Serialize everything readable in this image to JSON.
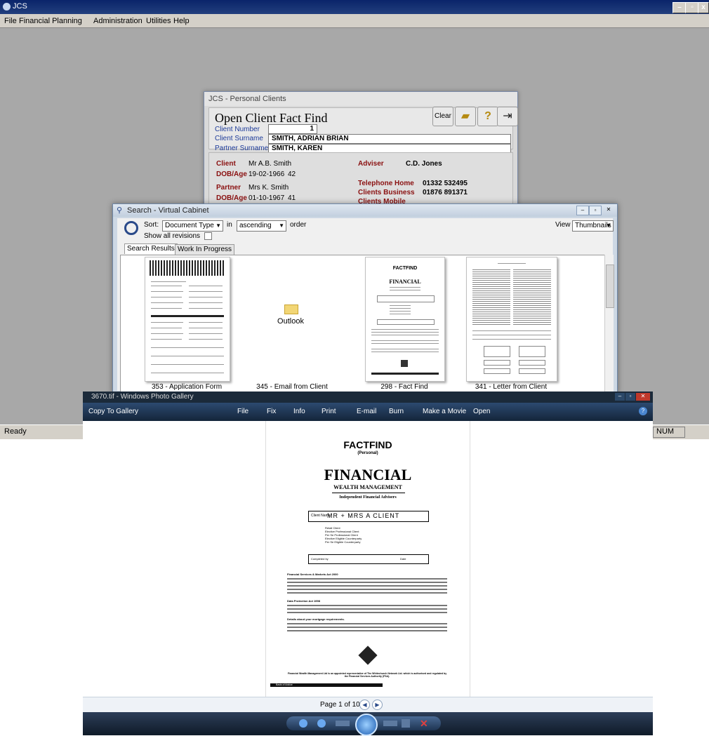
{
  "app": {
    "title": "JCS",
    "menu": [
      "File",
      "Financial Planning",
      "Administration",
      "Utilities",
      "Help"
    ],
    "status": "Ready",
    "num_indicator": "NUM"
  },
  "personal_clients": {
    "window_title": "JCS - Personal Clients",
    "heading": "Open Client Fact Find",
    "clear_label": "Clear",
    "client_number_label": "Client Number",
    "client_number_value": "1",
    "client_surname_label": "Client Surname",
    "client_surname_value": "SMITH, ADRIAN BRIAN",
    "partner_surname_label": "Partner Surname",
    "partner_surname_value": "SMITH, KAREN",
    "client_label": "Client",
    "client_value": "Mr A.B. Smith",
    "dob_label": "DOB/Age",
    "client_dob": "19-02-1966",
    "client_age": "42",
    "partner_label": "Partner",
    "partner_value": "Mrs K. Smith",
    "partner_dob": "01-10-1967",
    "partner_age": "41",
    "adviser_label": "Adviser",
    "adviser_value": "C.D. Jones",
    "tel_home_label": "Telephone Home",
    "tel_home_value": "01332 532495",
    "clients_business_label": "Clients Business",
    "clients_business_value": "01876 891371",
    "clients_mobile_label": "Clients Mobile"
  },
  "virtual_cabinet": {
    "window_title": "Search - Virtual Cabinet",
    "sort_label": "Sort:",
    "sort_value": "Document Type",
    "in_label": "in",
    "order_value": "ascending",
    "order_label": "order",
    "show_revisions_label": "Show all revisions",
    "view_label": "View",
    "view_value": "Thumbnails",
    "tabs": [
      "Search Results",
      "Work In Progress"
    ],
    "outlook_label": "Outlook",
    "results": [
      {
        "caption": "353 - Application Form"
      },
      {
        "caption": "345 - Email from Client"
      },
      {
        "caption": "298 - Fact Find"
      },
      {
        "caption": "341 - Letter from Client"
      }
    ],
    "thumb_factfind_title": "FACTFIND",
    "thumb_factfind_brand": "FINANCIAL"
  },
  "photo_gallery": {
    "window_title": "3670.tif - Windows Photo Gallery",
    "toolbar": [
      "Copy To Gallery",
      "File",
      "Fix",
      "Info",
      "Print",
      "E-mail",
      "Burn",
      "Make a Movie",
      "Open"
    ],
    "pager": "Page 1 of 10",
    "document": {
      "title": "FACTFIND",
      "subtitle": "(Personal)",
      "brand": "FINANCIAL",
      "brand_line2": "WEALTH MANAGEMENT",
      "brand_line3": "Independent Financial Advisers",
      "client_name_label": "Client Name",
      "client_name_value": "MR + MRS A CLIENT",
      "categories": [
        "Retail Client",
        "Elective Professional Client",
        "Per Se Professional Client",
        "Elective Eligible Counterparty",
        "Per Se Eligible Counterparty"
      ],
      "completed_by_label": "Completed by",
      "date_label": "Date",
      "section1": "Financial Services & Markets Act 2000",
      "section2": "Data Protection Act 1998",
      "section3": "Details about your mortgage requirements.",
      "footer": "Financial Wealth Management Ltd is an appointed representative of The Whitechurch Network Ltd. which is authorised and regulated by the Financial Services Authority (FSA).",
      "footer_box": "Basis of Advice"
    }
  },
  "colors": {
    "app_bg": "#a8a8a8",
    "title_bar": "#0a246a",
    "label_blue": "#1e3c9a",
    "label_red": "#8a1010",
    "gallery_bar": "#1b2a3a"
  }
}
